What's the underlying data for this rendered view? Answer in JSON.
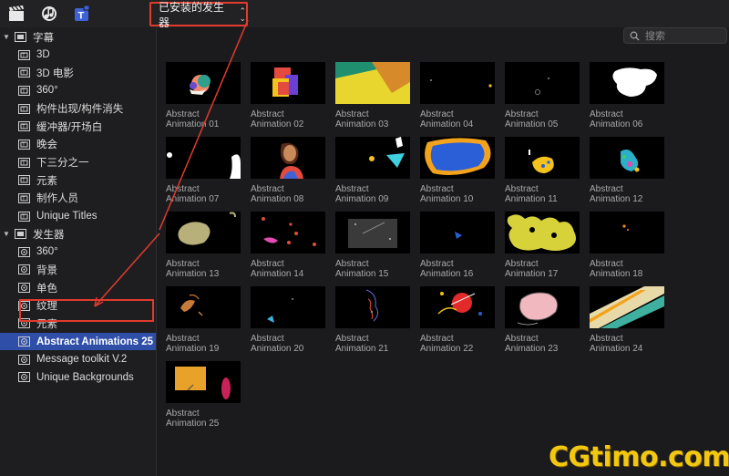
{
  "toolbar": {
    "icons": [
      "clapperboard-icon",
      "music-icon",
      "titles-generators-icon"
    ],
    "dropdown_label": "已安装的发生器"
  },
  "sidebar": {
    "titles_group": "字幕",
    "titles_items": [
      "3D",
      "3D 电影",
      "360°",
      "构件出现/构件消失",
      "缓冲器/开场白",
      "晚会",
      "下三分之一",
      "元素",
      "制作人员",
      "Unique Titles"
    ],
    "generators_group": "发生器",
    "generators_items": [
      "360°",
      "背景",
      "单色",
      "纹理",
      "元素",
      "Abstract Animations 25",
      "Message toolkit V.2",
      "Unique Backgrounds"
    ],
    "selected_item": "Abstract Animations 25"
  },
  "search": {
    "placeholder": "搜索"
  },
  "grid": {
    "items": [
      [
        "Abstract",
        "Animation 01"
      ],
      [
        "Abstract",
        "Animation 02"
      ],
      [
        "Abstract",
        "Animation 03"
      ],
      [
        "Abstract",
        "Animation 04"
      ],
      [
        "Abstract",
        "Animation 05"
      ],
      [
        "Abstract",
        "Animation 06"
      ],
      [
        "Abstract",
        "Animation 07"
      ],
      [
        "Abstract",
        "Animation 08"
      ],
      [
        "Abstract",
        "Animation 09"
      ],
      [
        "Abstract",
        "Animation 10"
      ],
      [
        "Abstract",
        "Animation 11"
      ],
      [
        "Abstract",
        "Animation 12"
      ],
      [
        "Abstract",
        "Animation 13"
      ],
      [
        "Abstract",
        "Animation 14"
      ],
      [
        "Abstract",
        "Animation 15"
      ],
      [
        "Abstract",
        "Animation 16"
      ],
      [
        "Abstract",
        "Animation 17"
      ],
      [
        "Abstract",
        "Animation 18"
      ],
      [
        "Abstract",
        "Animation 19"
      ],
      [
        "Abstract",
        "Animation 20"
      ],
      [
        "Abstract",
        "Animation 21"
      ],
      [
        "Abstract",
        "Animation 22"
      ],
      [
        "Abstract",
        "Animation 23"
      ],
      [
        "Abstract",
        "Animation 24"
      ],
      [
        "Abstract",
        "Animation 25"
      ]
    ]
  },
  "watermark": "CGtimo.com",
  "colors": {
    "accent_selected": "#2f4ea8",
    "annotation_red": "#e23b2e",
    "watermark_yellow": "#f2c80f"
  }
}
